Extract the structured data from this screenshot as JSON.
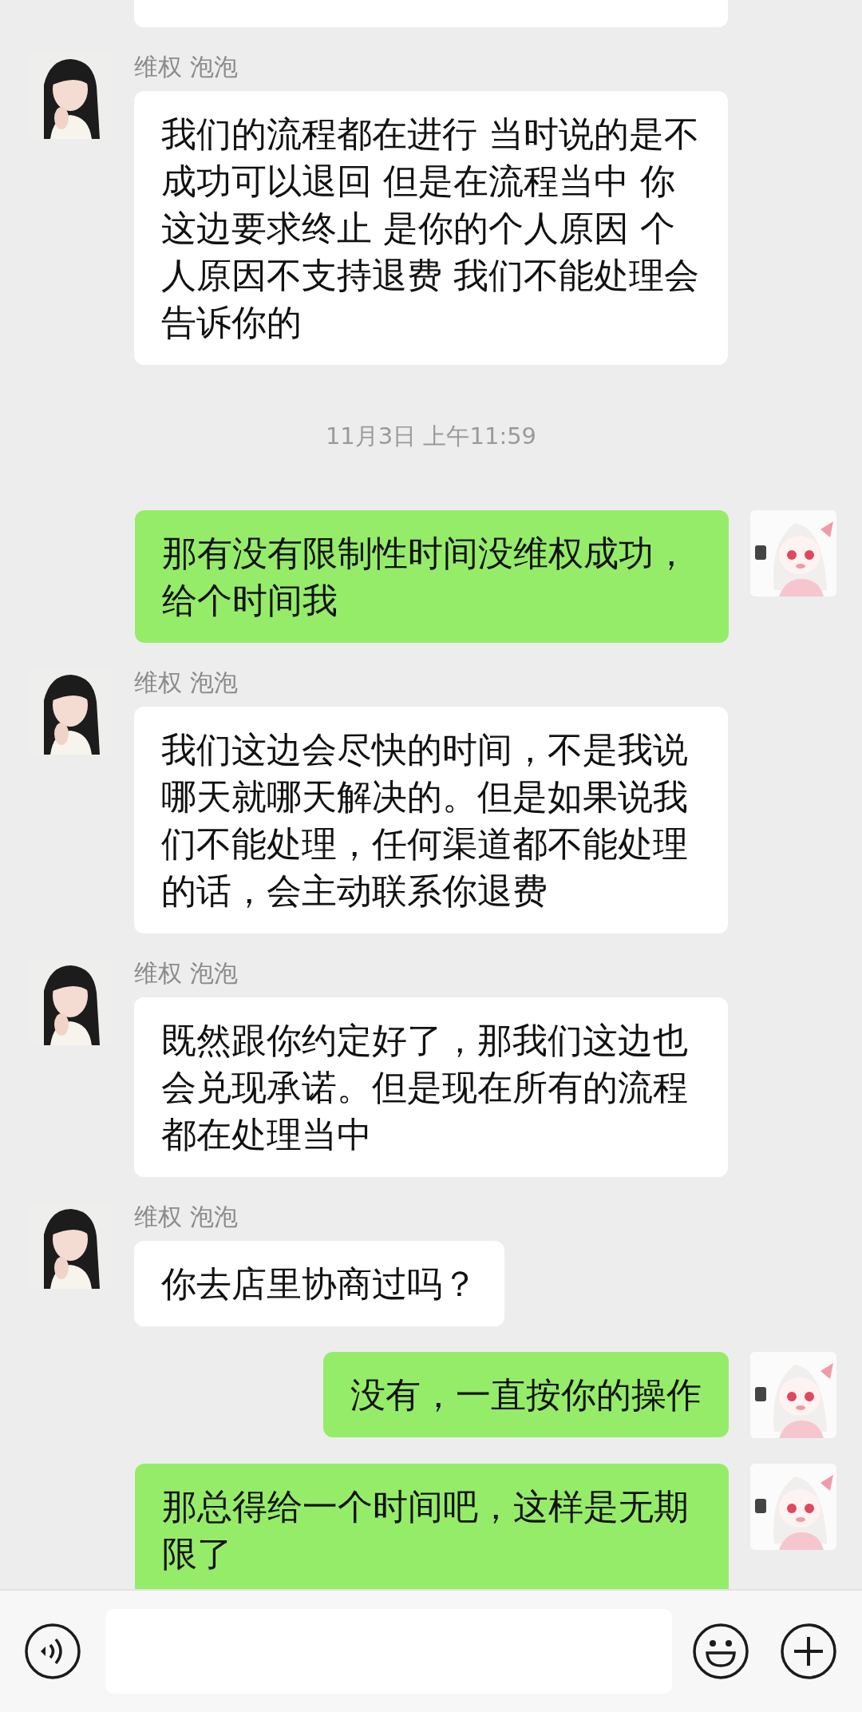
{
  "messages": [
    {
      "kind": "partial"
    },
    {
      "kind": "incoming",
      "sender": "维权 泡泡",
      "text": "我们的流程都在进行 当时说的是不成功可以退回 但是在流程当中 你这边要求终止 是你的个人原因 个人原因不支持退费 我们不能处理会告诉你的"
    },
    {
      "kind": "time",
      "text": "11月3日 上午11:59"
    },
    {
      "kind": "outgoing",
      "text": "那有没有限制性时间没维权成功，给个时间我"
    },
    {
      "kind": "incoming",
      "sender": "维权 泡泡",
      "text": "我们这边会尽快的时间，不是我说哪天就哪天解决的。但是如果说我们不能处理，任何渠道都不能处理的话，会主动联系你退费"
    },
    {
      "kind": "incoming",
      "sender": "维权 泡泡",
      "text": "既然跟你约定好了，那我们这边也会兑现承诺。但是现在所有的流程都在处理当中"
    },
    {
      "kind": "incoming",
      "sender": "维权 泡泡",
      "text": "你去店里协商过吗？"
    },
    {
      "kind": "outgoing",
      "text": "没有，一直按你的操作"
    },
    {
      "kind": "outgoing",
      "text": "那总得给一个时间吧，这样是无期限了"
    }
  ]
}
